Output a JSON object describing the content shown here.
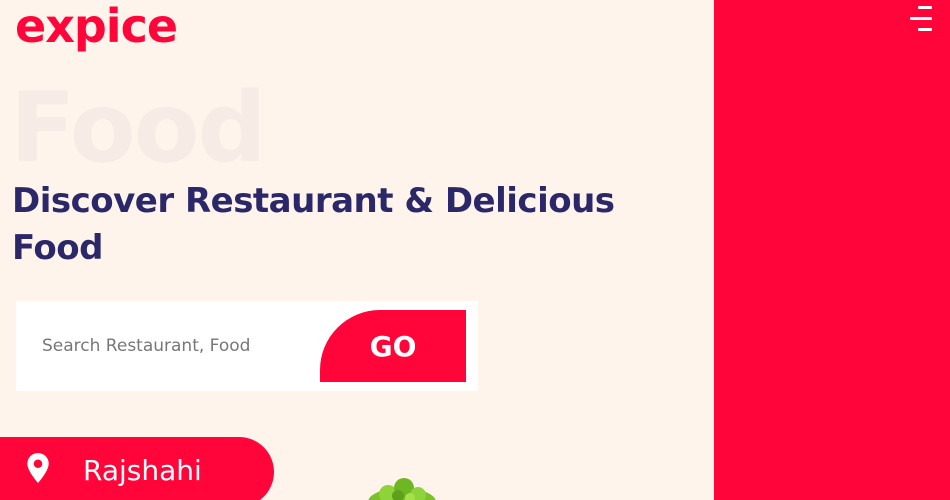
{
  "brand": {
    "logo_text": "expice"
  },
  "hero": {
    "background_word": "Food",
    "headline": "Discover Restaurant & Delicious Food"
  },
  "search": {
    "placeholder": "Search Restaurant, Food",
    "value": "",
    "button_label": "GO"
  },
  "location": {
    "label": "Rajshahi",
    "icon": "map-pin-icon"
  },
  "menu": {
    "icon": "hamburger-menu-icon"
  },
  "images": {
    "salad": "salad-image"
  },
  "colors": {
    "accent": "#FF0539",
    "background": "#FFF4EC",
    "headline": "#2B2869",
    "watermark": "#F6EBE5"
  }
}
